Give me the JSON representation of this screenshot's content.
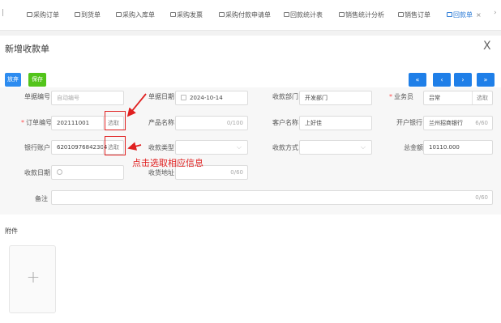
{
  "tabs": {
    "left_edge": "|",
    "items": [
      {
        "label": "采购订单"
      },
      {
        "label": "到货单"
      },
      {
        "label": "采购入库单"
      },
      {
        "label": "采购发票"
      },
      {
        "label": "采购付款申请单"
      },
      {
        "label": "回款统计表"
      },
      {
        "label": "销售统计分析"
      },
      {
        "label": "销售订单"
      },
      {
        "label": "回款单"
      }
    ],
    "active_close": "×",
    "more": "›"
  },
  "dialog": {
    "title": "新增收款单",
    "close": "X"
  },
  "toolbar": {
    "cancel_label": "放弃",
    "save_label": "保存",
    "pager": [
      "«",
      "‹",
      "›",
      "»"
    ]
  },
  "form": {
    "doc_no": {
      "label": "单据编号",
      "value": "自动编号"
    },
    "doc_date": {
      "label": "单据日期",
      "value": "2024-10-14"
    },
    "dept": {
      "label": "收款部门",
      "value": "开发部门"
    },
    "salesman": {
      "label": "业务员",
      "value": "吕常",
      "button": "选取"
    },
    "order_no": {
      "label": "订单编号",
      "value": "202111001",
      "button": "选取"
    },
    "product": {
      "label": "产品名称",
      "counter": "0/100"
    },
    "customer": {
      "label": "客户名称",
      "value": "上好佳"
    },
    "bank": {
      "label": "开户银行",
      "value": "兰州招商银行",
      "counter": "6/60"
    },
    "account": {
      "label": "银行账户",
      "value": "62010976842304",
      "button": "选取"
    },
    "pay_type": {
      "label": "收款类型"
    },
    "pay_method": {
      "label": "收款方式"
    },
    "total": {
      "label": "总金额",
      "value": "10110.000"
    },
    "recv_date": {
      "label": "收款日期"
    },
    "address": {
      "label": "收货地址",
      "counter": "0/60"
    },
    "remark": {
      "label": "备注",
      "counter": "0/60"
    }
  },
  "annotation": "点击选取相应信息",
  "attachment": {
    "title": "附件",
    "plus": "+"
  },
  "colors": {
    "accent": "#2d8cf0",
    "save": "#52c41a",
    "annotation": "#e02020",
    "required": "#ff4d4f"
  }
}
